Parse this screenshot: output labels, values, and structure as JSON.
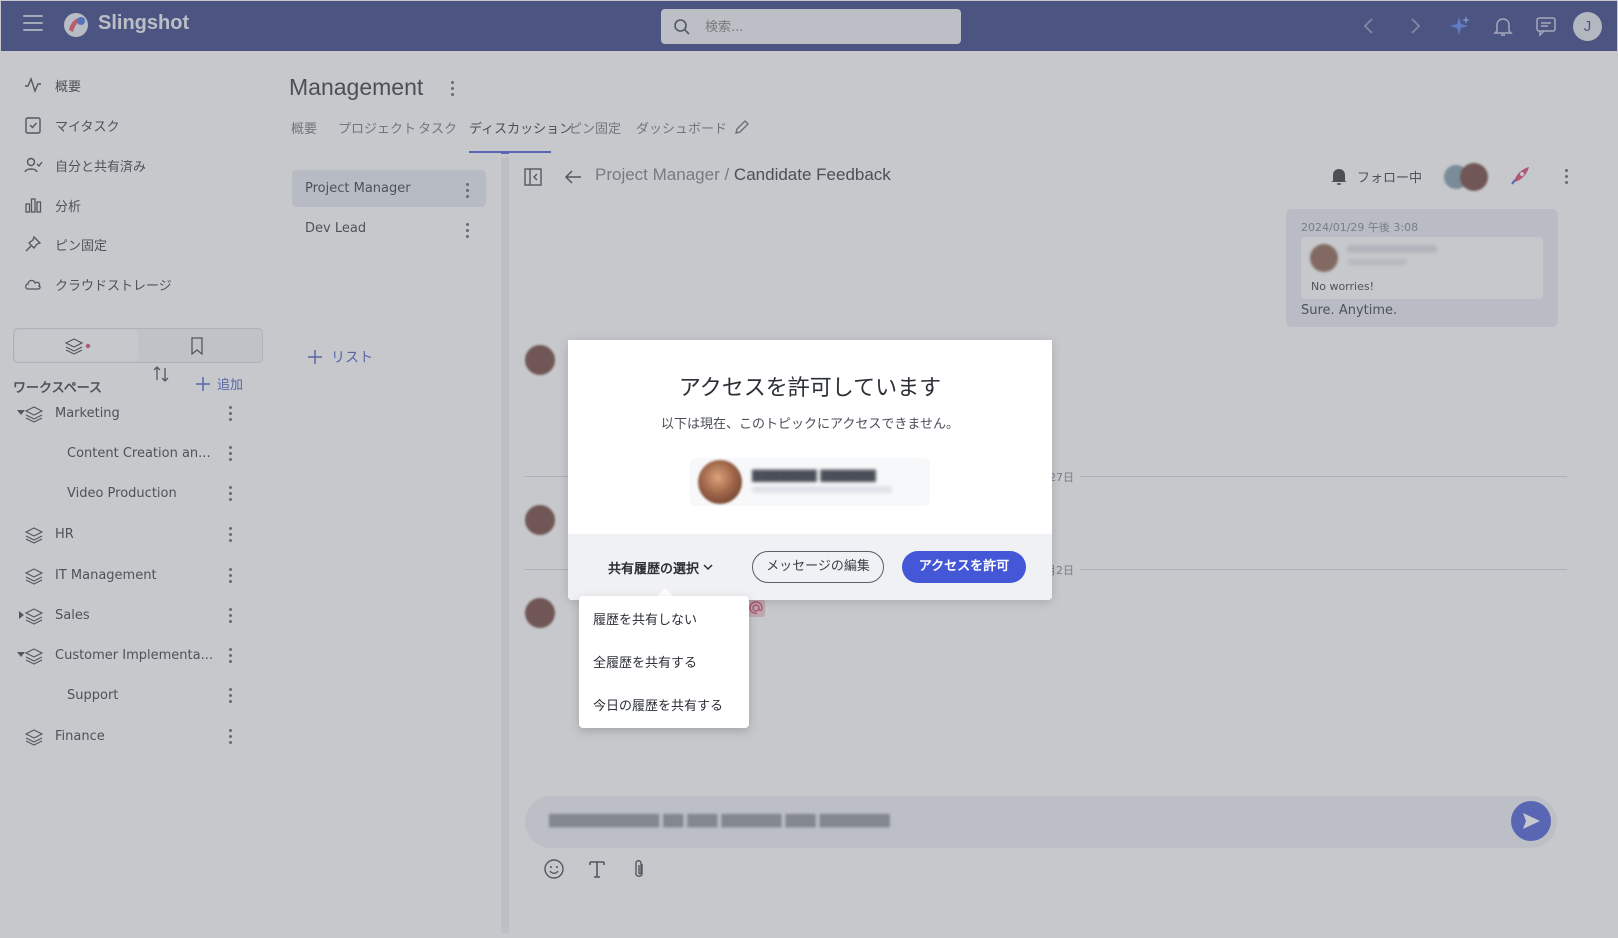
{
  "app": {
    "brand": "Slingshot"
  },
  "search": {
    "placeholder": "検索..."
  },
  "topbar": {
    "avatar_initial": "J"
  },
  "nav": [
    {
      "label": "概要",
      "icon": "activity-icon"
    },
    {
      "label": "マイタスク",
      "icon": "task-check-icon"
    },
    {
      "label": "自分と共有済み",
      "icon": "shared-user-icon"
    },
    {
      "label": "分析",
      "icon": "bar-chart-icon"
    },
    {
      "label": "ピン固定",
      "icon": "pin-icon"
    },
    {
      "label": "クラウドストレージ",
      "icon": "cloud-icon"
    }
  ],
  "workspace": {
    "title": "ワークスペース",
    "add_label": "追加",
    "items": [
      {
        "label": "Marketing",
        "level": 0,
        "caret": "down"
      },
      {
        "label": "Content Creation an...",
        "level": 1
      },
      {
        "label": "Video Production",
        "level": 1
      },
      {
        "label": "HR",
        "level": 0
      },
      {
        "label": "IT Management",
        "level": 0
      },
      {
        "label": "Sales",
        "level": 0,
        "caret": "right"
      },
      {
        "label": "Customer Implementa...",
        "level": 0,
        "caret": "down"
      },
      {
        "label": "Support",
        "level": 1
      },
      {
        "label": "Finance",
        "level": 0
      }
    ]
  },
  "main": {
    "title": "Management",
    "tabs": [
      "概要",
      "プロジェクト",
      "タスク",
      "ディスカッション",
      "ピン固定",
      "ダッシュボード"
    ],
    "active_tab": "ディスカッション"
  },
  "lists": {
    "items": [
      "Project Manager",
      "Dev Lead"
    ],
    "add_label": "リスト"
  },
  "conversation": {
    "breadcrumb_parent": "Project Manager /",
    "breadcrumb_current": "Candidate Feedback",
    "follow_label": "フォロー中",
    "message": {
      "timestamp": "2024/01/29 午後 3:08",
      "quoted_text": "No worries!",
      "body": "Sure. Anytime."
    },
    "date_dividers": [
      "2月27日",
      "10月2日"
    ]
  },
  "dialog": {
    "title": "アクセスを許可しています",
    "subtitle": "以下は現在、このトピックにアクセスできません。",
    "history_select_label": "共有履歴の選択",
    "edit_message_label": "メッセージの編集",
    "allow_label": "アクセスを許可"
  },
  "history_menu": {
    "options": [
      "履歴を共有しない",
      "全履歴を共有する",
      "今日の履歴を共有する"
    ]
  },
  "colors": {
    "topbar": "#2d3982",
    "accent": "#4457d6",
    "background": "#eef0f4"
  }
}
